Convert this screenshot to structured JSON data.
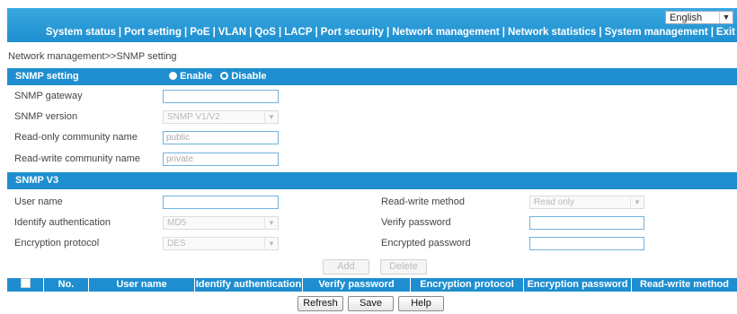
{
  "header": {
    "language": "English",
    "nav": [
      "System status",
      "Port setting",
      "PoE",
      "VLAN",
      "QoS",
      "LACP",
      "Port security",
      "Network management",
      "Network statistics",
      "System management",
      "Exit"
    ]
  },
  "breadcrumb": "Network management>>SNMP setting",
  "snmp": {
    "title": "SNMP setting",
    "enable_label": "Enable",
    "disable_label": "Disable",
    "selected": "Disable",
    "gateway_label": "SNMP gateway",
    "gateway_value": "",
    "version_label": "SNMP version",
    "version_value": "SNMP V1/V2",
    "ro_label": "Read-only community name",
    "ro_value": "public",
    "rw_label": "Read-write community name",
    "rw_value": "private"
  },
  "v3": {
    "title": "SNMP V3",
    "username_label": "User name",
    "username_value": "",
    "rw_method_label": "Read-write method",
    "rw_method_value": "Read only",
    "auth_label": "Identify authentication",
    "auth_value": "MD5",
    "verify_label": "Verify password",
    "verify_value": "",
    "enc_label": "Encryption protocol",
    "enc_value": "DES",
    "enc_pwd_label": "Encrypted password",
    "enc_pwd_value": "",
    "add_label": "Add",
    "delete_label": "Delete"
  },
  "table": {
    "columns": [
      "No.",
      "User name",
      "Identify authentication",
      "Verify password",
      "Encryption protocol",
      "Encryption password",
      "Read-write method"
    ]
  },
  "footer": {
    "refresh": "Refresh",
    "save": "Save",
    "help": "Help"
  },
  "colors": {
    "header_blue": "#1e8ed0",
    "input_border": "#6fb3df"
  }
}
